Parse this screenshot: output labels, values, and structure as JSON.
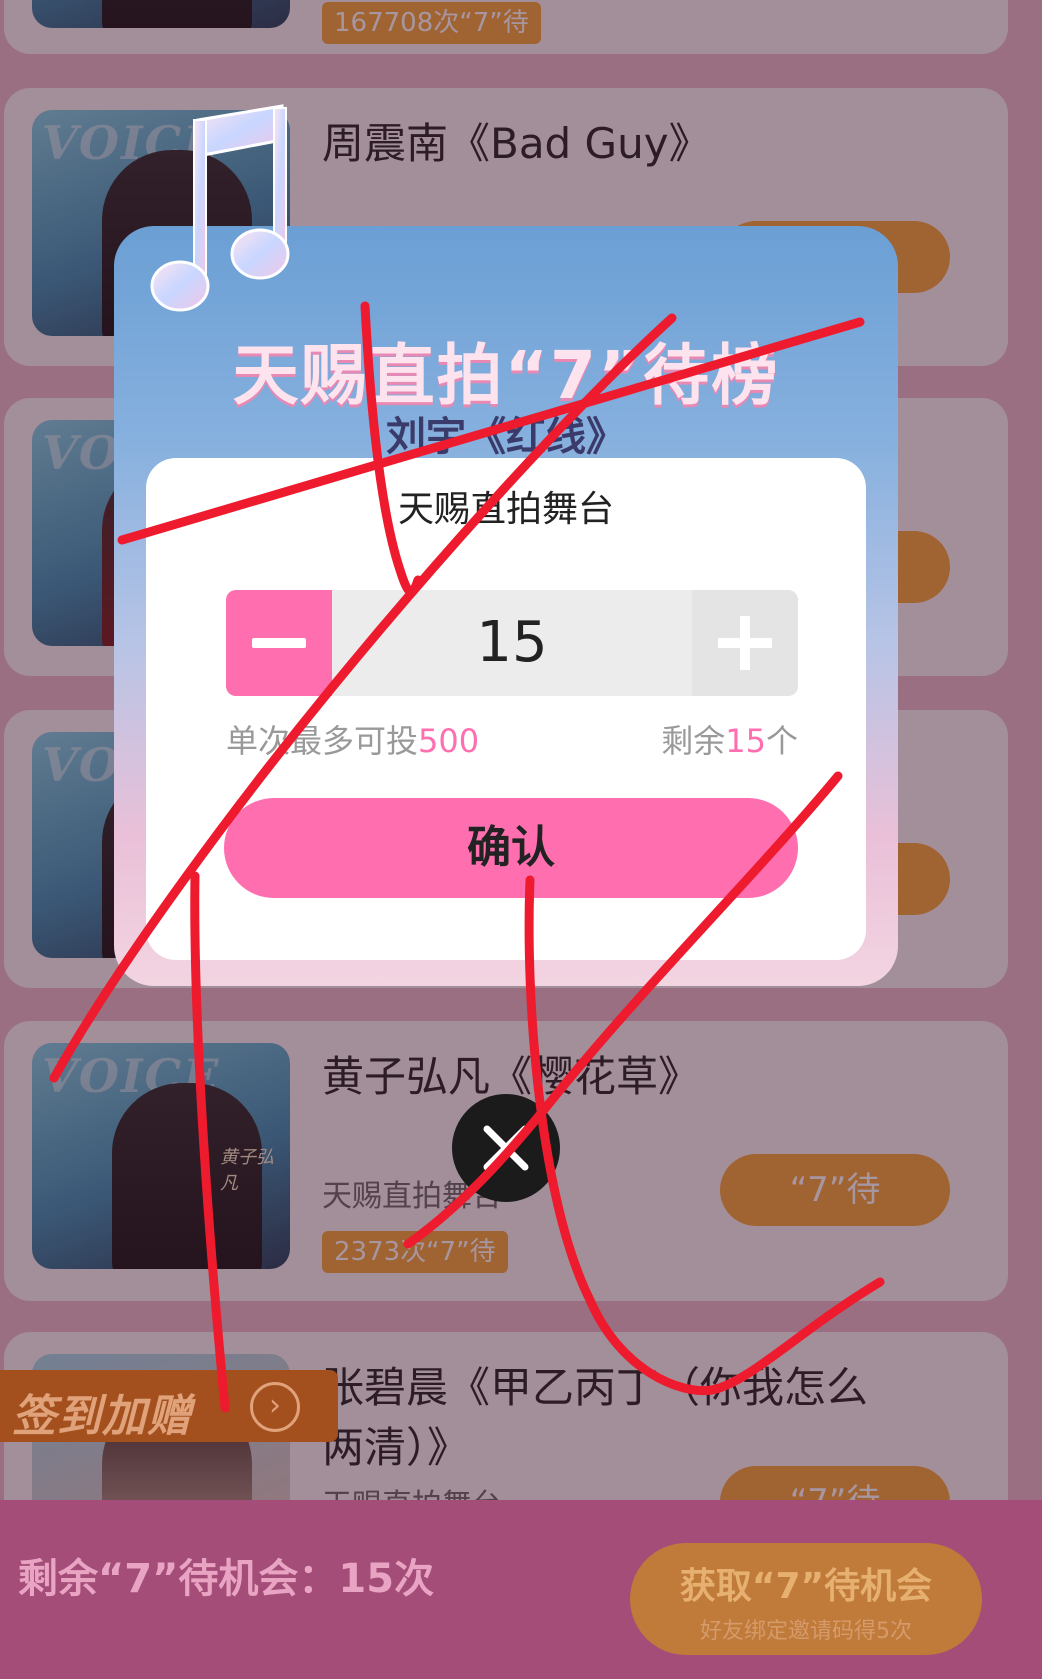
{
  "list": {
    "cards": [
      {
        "song": "",
        "stage": "",
        "count": "167708次“7”待",
        "button": ""
      },
      {
        "song": "周震南《Bad Guy》",
        "stage": "",
        "count": "",
        "button": ""
      },
      {
        "song": "",
        "stage": "",
        "count": "",
        "button": ""
      },
      {
        "song": "",
        "stage": "",
        "count": "",
        "button": ""
      },
      {
        "song": "黄子弘凡《樱花草》",
        "stage": "天赐直拍舞台",
        "count": "2373次“7”待",
        "button": "“7”待",
        "thumb_sig": "黄子弘凡"
      },
      {
        "song_line1": "张碧晨《甲乙丙丁（你我怎么",
        "song_line2": "两清）》",
        "stage": "天赐直拍舞台",
        "count": "",
        "button": "“7”待"
      }
    ],
    "thumb_watermark": "VOICE"
  },
  "signin_banner": {
    "label": "签到加赠",
    "icon": "chevron-right-circle-icon"
  },
  "bottom_bar": {
    "remaining_text": "剩余“7”待机会：15次",
    "get_button_main": "获取“7”待机会",
    "get_button_sub": "好友绑定邀请码得5次"
  },
  "dialog": {
    "title": "天赐直拍“7”待榜",
    "subtitle": "刘宇《红线》",
    "stage_name": "天赐直拍舞台",
    "quantity": "15",
    "hint_left_prefix": "单次最多可投",
    "hint_left_value": "500",
    "hint_right_prefix": "剩余",
    "hint_right_value": "15",
    "hint_right_suffix": "个",
    "confirm_label": "确认",
    "icons": {
      "minus": "minus-icon",
      "plus": "plus-icon",
      "decoration": "music-note-icon",
      "close": "close-icon"
    }
  },
  "colors": {
    "pink_accent": "#ff6fb0",
    "orange": "#f2a23a",
    "scribble_red": "#ee1b2e",
    "bottom_bar": "#a34d78"
  }
}
